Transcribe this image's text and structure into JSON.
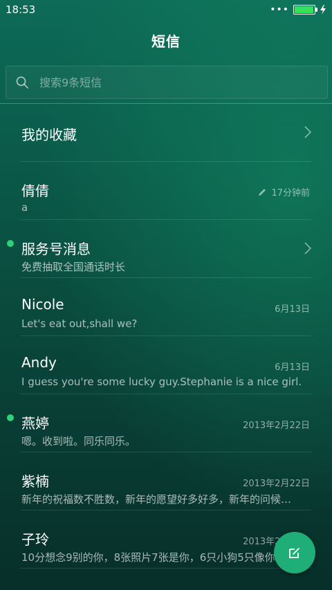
{
  "status_bar": {
    "time": "18:53",
    "battery_level": 0.9
  },
  "header": {
    "title": "短信"
  },
  "search": {
    "placeholder": "搜索9条短信"
  },
  "conversations": [
    {
      "title": "我的收藏",
      "subtitle": "",
      "date": "",
      "unread": false,
      "chevron": true
    },
    {
      "title": "倩倩",
      "subtitle": "a",
      "date": "17分钟前",
      "unread": false,
      "draft": true
    },
    {
      "title": "服务号消息",
      "subtitle": "免费抽取全国通话时长",
      "date": "",
      "unread": true,
      "chevron": true
    },
    {
      "title": "Nicole",
      "subtitle": "Let's eat out,shall we?",
      "date": "6月13日",
      "unread": false
    },
    {
      "title": "Andy",
      "subtitle": "I guess you're some lucky guy.Stephanie is a nice girl.",
      "date": "6月13日",
      "unread": false
    },
    {
      "title": "燕婷",
      "subtitle": "嗯。收到啦。同乐同乐。",
      "date": "2013年2月22日",
      "unread": true
    },
    {
      "title": "紫楠",
      "subtitle": "新年的祝福数不胜数，新年的愿望好多好多，新年的问候…",
      "date": "2013年2月22日",
      "unread": false
    },
    {
      "title": "子玲",
      "subtitle": "10分想念9别的你，8张照片7张是你，6只小狗5只像你",
      "date": "2013年2月22日",
      "unread": false
    }
  ],
  "colors": {
    "accent": "#1fae77",
    "unread_dot": "#2fd07a",
    "battery": "#35e05a"
  },
  "icons": {
    "search": "search-icon",
    "compose": "compose-icon",
    "chevron": "chevron-right-icon",
    "draft": "pencil-icon"
  }
}
